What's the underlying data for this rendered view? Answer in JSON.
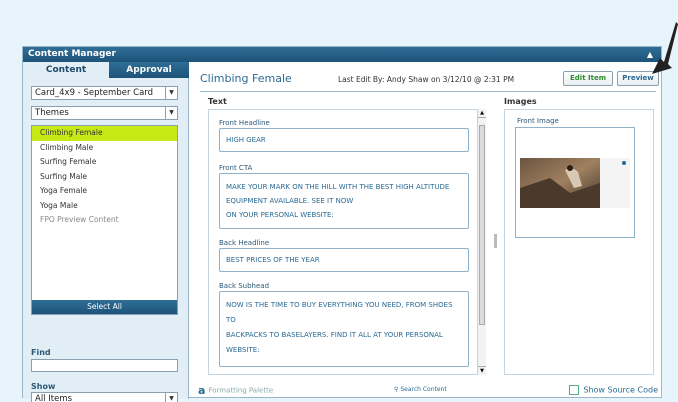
{
  "window": {
    "title": "Content Manager",
    "pin_icon": "pin-icon"
  },
  "left": {
    "tabs": [
      {
        "label": "Content",
        "active": true
      },
      {
        "label": "Approval",
        "active": false
      }
    ],
    "card_select": "Card_4x9 - September Card",
    "themes_select": "Themes",
    "list": [
      {
        "label": "Climbing Female",
        "selected": true
      },
      {
        "label": "Climbing Male"
      },
      {
        "label": "Surfing Female"
      },
      {
        "label": "Surfing Male"
      },
      {
        "label": "Yoga Female"
      },
      {
        "label": "Yoga Male"
      },
      {
        "label": "FPO Preview Content",
        "muted": true
      }
    ],
    "select_all": "Select All",
    "find_label": "Find",
    "find_value": "",
    "show_label": "Show",
    "show_select": "All Items"
  },
  "main": {
    "title": "Climbing Female",
    "last_edit": "Last Edit By: Andy Shaw on 3/12/10 @ 2:31 PM",
    "edit_button": "Edit Item",
    "preview_button": "Preview",
    "text_section": "Text",
    "images_section": "Images",
    "fields": [
      {
        "label": "Front Headline",
        "lines": [
          "HIGH GEAR"
        ]
      },
      {
        "label": "Front CTA",
        "lines": [
          "MAKE YOUR MARK ON THE HILL WITH THE BEST HIGH ALTITUDE",
          "EQUIPMENT AVAILABLE. SEE IT NOW",
          "ON YOUR PERSONAL WEBSITE:"
        ]
      },
      {
        "label": "Back Headline",
        "lines": [
          "BEST PRICES OF THE YEAR"
        ]
      },
      {
        "label": "Back Subhead",
        "lines": [
          "NOW IS THE TIME TO BUY EVERYTHING YOU NEED, FROM SHOES",
          "TO",
          "BACKPACKS TO BASELAYERS. FIND IT ALL AT YOUR PERSONAL",
          "WEBSITE:"
        ]
      }
    ],
    "front_image_label": "Front Image",
    "footer": {
      "formatting_palette": "Formatting Palette",
      "search_content": "Search Content",
      "show_source": "Show Source Code"
    }
  },
  "colors": {
    "accent": "#2a6a94",
    "header": "#1d5378",
    "selected": "#c7ea17",
    "page_bg": "#e8f4fb"
  }
}
